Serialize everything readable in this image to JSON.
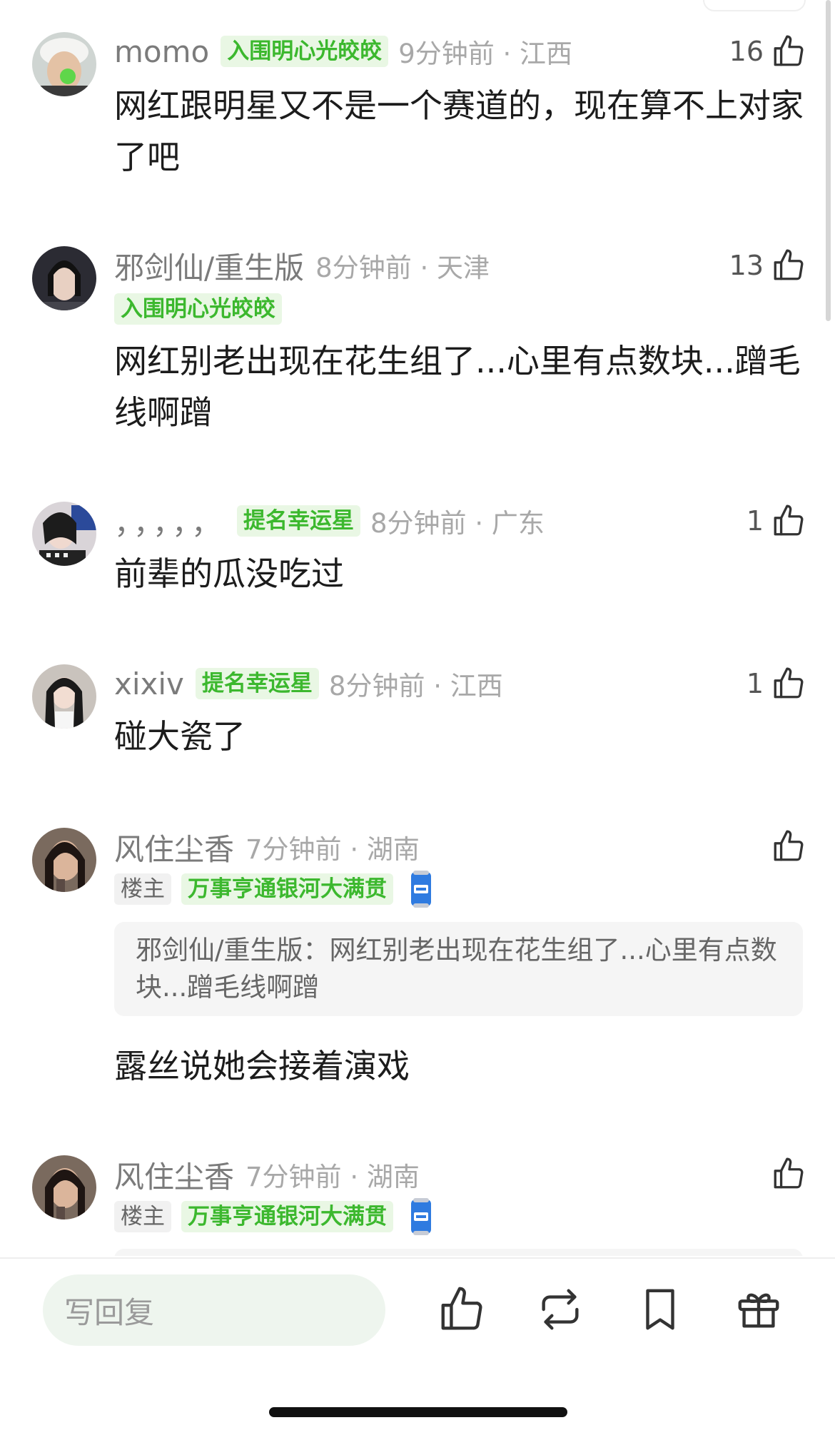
{
  "comments": [
    {
      "username": "momo",
      "badges": [
        "入围明心光皎皎"
      ],
      "timestamp": "9分钟前 · 江西",
      "likes": "16",
      "content": "网红跟明星又不是一个赛道的，现在算不上对家了吧"
    },
    {
      "username": "邪剑仙/重生版",
      "badges": [
        "入围明心光皎皎"
      ],
      "timestamp": "8分钟前 · 天津",
      "likes": "13",
      "content": "网红别老出现在花生组了...心里有点数块...蹭毛线啊蹭"
    },
    {
      "username": "，，，，，",
      "badges": [
        "提名幸运星"
      ],
      "timestamp": "8分钟前 · 广东",
      "likes": "1",
      "content": "前辈的瓜没吃过"
    },
    {
      "username": "xixiv",
      "badges": [
        "提名幸运星"
      ],
      "timestamp": "8分钟前 · 江西",
      "likes": "1",
      "content": "碰大瓷了"
    },
    {
      "username": "风住尘香",
      "badges": [
        "楼主",
        "万事亨通银河大满贯"
      ],
      "timestamp": "7分钟前 · 湖南",
      "likes": "",
      "quote": "邪剑仙/重生版：网红别老出现在花生组了...心里有点数块...蹭毛线啊蹭",
      "content": "露丝说她会接着演戏"
    },
    {
      "username": "风住尘香",
      "badges": [
        "楼主",
        "万事亨通银河大满贯"
      ],
      "timestamp": "7分钟前 · 湖南",
      "likes": ""
    }
  ],
  "bottom_bar": {
    "reply_placeholder": "写回复",
    "icons": [
      "like-icon",
      "repost-icon",
      "bookmark-icon",
      "gift-icon"
    ]
  },
  "colors": {
    "badge_green": "#3cb82e",
    "badge_bg": "#e9f7e4",
    "input_bg": "#eef5ee"
  }
}
